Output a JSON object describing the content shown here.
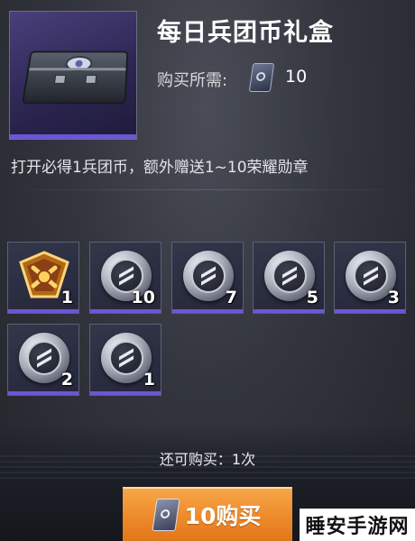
{
  "item": {
    "title": "每日兵团币礼盒",
    "cost_label": "购买所需:",
    "cost_icon": "legion-coin-card-icon",
    "cost_value": "10",
    "description": "打开必得1兵团币，额外赠送1~10荣耀勋章"
  },
  "rewards": [
    {
      "icon": "glory-medal-icon",
      "count": "1"
    },
    {
      "icon": "silver-coin-icon",
      "count": "10"
    },
    {
      "icon": "silver-coin-icon",
      "count": "7"
    },
    {
      "icon": "silver-coin-icon",
      "count": "5"
    },
    {
      "icon": "silver-coin-icon",
      "count": "3"
    },
    {
      "icon": "silver-coin-icon",
      "count": "2"
    },
    {
      "icon": "silver-coin-icon",
      "count": "1"
    }
  ],
  "purchase": {
    "remaining_text": "还可购买：1次",
    "button_label": "10购买",
    "button_icon": "legion-coin-card-icon"
  },
  "watermark": "睡安手游网",
  "colors": {
    "accent": "#6b56d8",
    "button": "#ee8a2a"
  }
}
